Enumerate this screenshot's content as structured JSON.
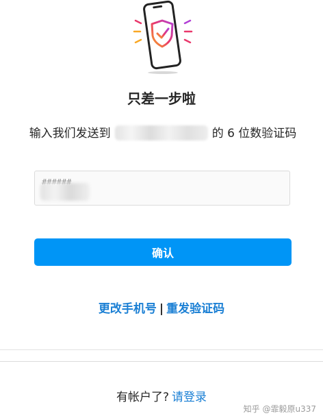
{
  "title": "只差一步啦",
  "message": {
    "before": "输入我们发送到",
    "after": "的 6 位数验证码"
  },
  "code_input": {
    "placeholder": "######"
  },
  "confirm_button": {
    "label": "确认"
  },
  "links": {
    "change_phone": "更改手机号",
    "separator": "|",
    "resend_code": "重发验证码"
  },
  "footer": {
    "prompt": "有帐户了?",
    "login_link": "请登录"
  },
  "watermark": "知乎 @霏毅原u337",
  "colors": {
    "accent": "#0095f6",
    "link": "#1a7fd4"
  },
  "illustration_icon": "phone-shield-check-icon"
}
